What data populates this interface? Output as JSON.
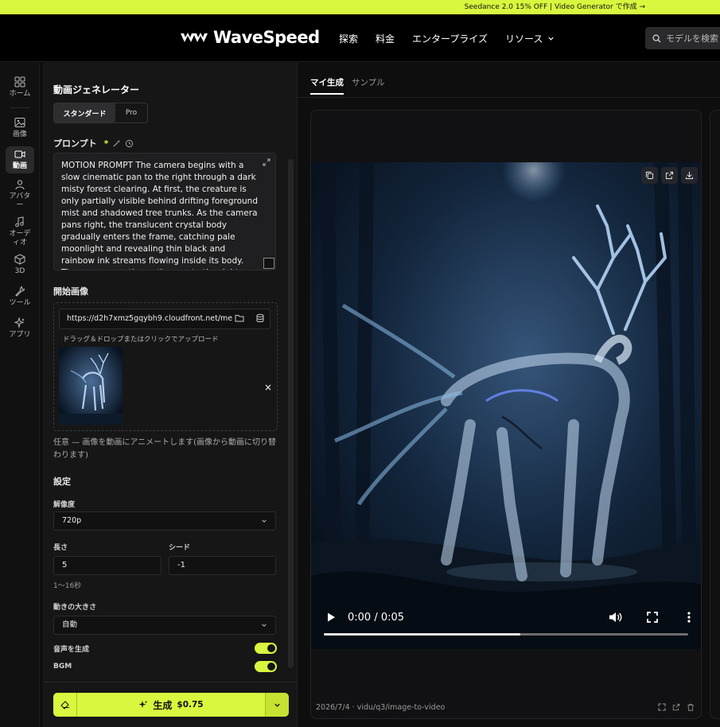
{
  "banner": {
    "text": "Seedance 2.0 15% OFF | Video Generator で作成 →"
  },
  "brand": {
    "name": "WaveSpeed",
    "accent": "#d9f73e"
  },
  "nav": {
    "items": [
      {
        "label": "探索"
      },
      {
        "label": "料金"
      },
      {
        "label": "エンタープライズ"
      },
      {
        "label": "リソース"
      }
    ],
    "search_placeholder": "モデルを検索"
  },
  "rail": {
    "home": "ホーム",
    "items": [
      {
        "label": "画像"
      },
      {
        "label": "動画"
      },
      {
        "label": "アバター"
      },
      {
        "label": "オーディオ"
      },
      {
        "label": "3D"
      },
      {
        "label": "ツール"
      },
      {
        "label": "アプリ"
      }
    ]
  },
  "panel": {
    "title": "動画ジェネレーター",
    "modes": {
      "standard": "スタンダード",
      "pro": "Pro"
    },
    "prompt": {
      "label": "プロンプト",
      "required_mark": "*",
      "value": "MOTION PROMPT The camera begins with a slow cinematic pan to the right through a dark misty forest clearing. At first, the creature is only partially visible behind drifting foreground mist and shadowed tree trunks. As the camera pans right, the translucent crystal body gradually enters the frame, catching pale moonlight and revealing thin black and rainbow ink streams flowing inside its body. The camera continues the pan to the right as the creature turns its head toward the light."
    },
    "start_image": {
      "label": "開始画像",
      "url": "https://d2h7xmz5gqybh9.cloudfront.net/me",
      "hint": "ドラッグ＆ドロップまたはクリックでアップロード",
      "remove": "×",
      "note": "任意 — 画像を動画にアニメートします(画像から動画に切り替わります)"
    },
    "settings": {
      "label": "設定",
      "resolution_label": "解像度",
      "resolution_value": "720p",
      "length_label": "長さ",
      "length_value": "5",
      "seed_label": "シード",
      "seed_value": "-1",
      "length_hint": "1〜16秒",
      "motion_label": "動きの大きさ",
      "motion_value": "自動",
      "audio_label": "音声を生成",
      "audio_on": true,
      "bgm_label": "BGM",
      "bgm_on": true
    },
    "generate": {
      "label": "生成",
      "price": "$0.75"
    }
  },
  "main": {
    "tabs": [
      {
        "label": "マイ生成"
      },
      {
        "label": "サンプル"
      }
    ],
    "player": {
      "time": "0:00 / 0:05",
      "progress": 0.54
    },
    "meta": "2026/7/4 · vidu/q3/image-to-video"
  }
}
